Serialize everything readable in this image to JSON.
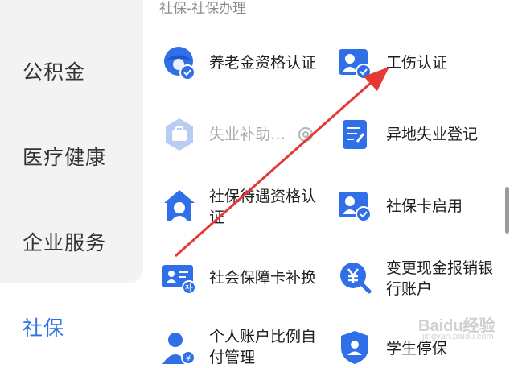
{
  "sidebar": {
    "items": [
      {
        "label": "公积金"
      },
      {
        "label": "医疗健康"
      },
      {
        "label": "企业服务"
      },
      {
        "label": "社保"
      }
    ]
  },
  "section": {
    "title": "社保-社保办理"
  },
  "services": [
    {
      "label": "养老金资格认证",
      "icon": "pension-user-check-icon"
    },
    {
      "label": "工伤认证",
      "icon": "injury-certify-icon"
    },
    {
      "label": "失业补助…",
      "icon": "briefcase-icon",
      "badge_icon": "info-circle-icon"
    },
    {
      "label": "异地失业登记",
      "icon": "register-document-icon"
    },
    {
      "label": "社保待遇资格认证",
      "icon": "home-user-icon"
    },
    {
      "label": "社保卡启用",
      "icon": "card-activate-icon"
    },
    {
      "label": "社会保障卡补换",
      "icon": "id-card-replace-icon"
    },
    {
      "label": "变更现金报销银行账户",
      "icon": "yuan-search-icon"
    },
    {
      "label": "个人账户比例自付管理",
      "icon": "personal-account-icon"
    },
    {
      "label": "学生停保",
      "icon": "student-shield-icon"
    }
  ],
  "colors": {
    "accent": "#2f6fe7",
    "icon_blue": "#2f6fe7",
    "arrow": "#e53935"
  },
  "watermark": {
    "brand": "Baidu经验",
    "sub": "jingyan.baidu.com"
  }
}
